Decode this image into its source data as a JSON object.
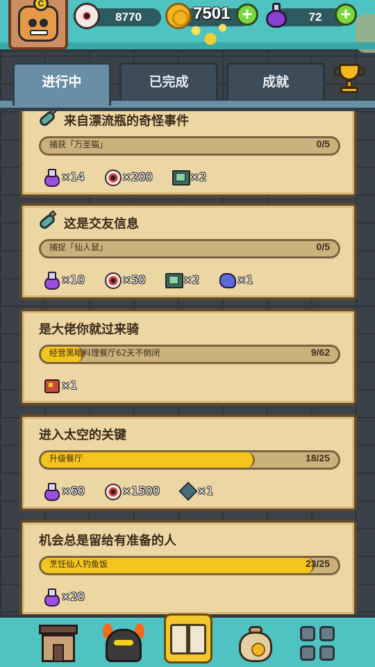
{
  "currencies": {
    "eyeballs": "8770",
    "coins": "7501",
    "potions": "72"
  },
  "tabs": [
    {
      "label": "进行中",
      "active": true
    },
    {
      "label": "已完成",
      "active": false
    },
    {
      "label": "成就",
      "active": false
    }
  ],
  "quests": [
    {
      "title": "来自漂流瓶的奇怪事件",
      "has_bottle": true,
      "task": "捕获「万圣猫」",
      "progress_text": "0/5",
      "progress": 0.0,
      "rewards": [
        {
          "icon": "potion-icon",
          "qty": "×14"
        },
        {
          "icon": "eyeball-icon",
          "qty": "×200"
        },
        {
          "icon": "card-icon",
          "qty": "×2"
        }
      ]
    },
    {
      "title": "这是交友信息",
      "has_bottle": true,
      "task": "捕捉「仙人鼠」",
      "progress_text": "0/5",
      "progress": 0.0,
      "rewards": [
        {
          "icon": "potion-icon",
          "qty": "×10"
        },
        {
          "icon": "eyeball-icon",
          "qty": "×50"
        },
        {
          "icon": "card-icon",
          "qty": "×2"
        },
        {
          "icon": "ore-icon",
          "qty": "×1"
        }
      ]
    },
    {
      "title": "是大佬你就过来骑",
      "has_bottle": false,
      "task": "经营黑暗料理餐厅62天不倒闭",
      "progress_text": "9/62",
      "progress": 0.145,
      "rewards": [
        {
          "icon": "chest-icon",
          "qty": "×1"
        }
      ]
    },
    {
      "title": "进入太空的关键",
      "has_bottle": false,
      "task": "升级餐厅",
      "progress_text": "18/25",
      "progress": 0.72,
      "rewards": [
        {
          "icon": "potion-icon",
          "qty": "×60"
        },
        {
          "icon": "eyeball-icon",
          "qty": "×1500"
        },
        {
          "icon": "badge-icon",
          "qty": "×1"
        }
      ]
    },
    {
      "title": "机会总是留给有准备的人",
      "has_bottle": false,
      "task": "烹饪仙人钓鱼饭",
      "progress_text": "23/25",
      "progress": 0.92,
      "rewards": [
        {
          "icon": "potion-icon",
          "qty": "×20"
        }
      ]
    }
  ],
  "colors": {
    "topbar": "#4ec3c2",
    "card": "#ecd6a3",
    "progress_fill": "#f6c51c",
    "tab_active": "#6a8ea5"
  }
}
